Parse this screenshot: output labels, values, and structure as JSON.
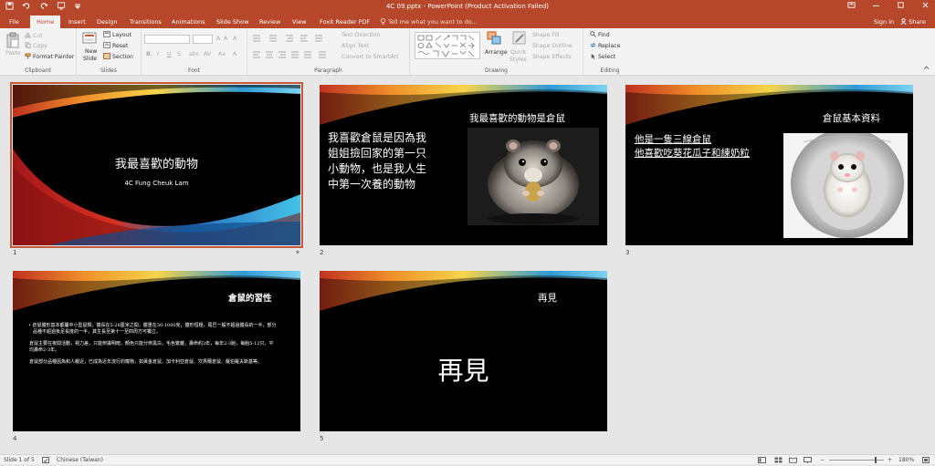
{
  "window": {
    "title": "4C 09.pptx - PowerPoint (Product Activation Failed)",
    "qat": [
      "save-icon",
      "undo-icon",
      "redo-icon",
      "slideshow-icon",
      "customize-icon"
    ],
    "controls": [
      "minimize",
      "restore",
      "maximize",
      "close"
    ]
  },
  "tabs": [
    "File",
    "Home",
    "Insert",
    "Design",
    "Transitions",
    "Animations",
    "Slide Show",
    "Review",
    "View",
    "Foxit Reader PDF"
  ],
  "tell_me": "Tell me what you want to do...",
  "sign_in": "Sign in",
  "share": "Share",
  "ribbon": {
    "clipboard": {
      "paste": "Paste",
      "cut": "Cut",
      "copy": "Copy",
      "format_painter": "Format Painter",
      "label": "Clipboard"
    },
    "slides": {
      "new_slide": "New",
      "new_slide2": "Slide",
      "layout": "Layout",
      "reset": "Reset",
      "section": "Section",
      "label": "Slides"
    },
    "font": {
      "bold": "B",
      "italic": "I",
      "underline": "U",
      "strike": "S",
      "label": "Font"
    },
    "paragraph": {
      "text_direction": "Text Direction",
      "align_text": "Align Text",
      "smartart": "Convert to SmartArt",
      "label": "Paragraph"
    },
    "drawing": {
      "arrange": "Arrange",
      "quick": "Quick",
      "styles": "Styles",
      "shape_fill": "Shape Fill",
      "shape_outline": "Shape Outline",
      "shape_effects": "Shape Effects",
      "label": "Drawing"
    },
    "editing": {
      "find": "Find",
      "replace": "Replace",
      "select": "Select",
      "label": "Editing"
    }
  },
  "slides": [
    {
      "num": "1",
      "title": "我最喜歡的動物",
      "subtitle": "4C  Fung  Cheuk Lam"
    },
    {
      "num": "2",
      "title": "我最喜歡的動物是倉鼠",
      "body": [
        "我喜歡倉鼠是因為我",
        "姐姐撿回家的第一只",
        "小動物，也是我人生",
        "中第一次養的動物"
      ]
    },
    {
      "num": "3",
      "title": "倉鼠基本資料",
      "body": [
        "他是一隻三線倉鼠",
        "他喜歡吃葵花瓜子和練奶粒"
      ]
    },
    {
      "num": "4",
      "title": "倉鼠的習性",
      "body": [
        "倉鼠體形基本都屬中小型鼠類，體長在5-28厘米之間，體重在30-1000克，體形短粗，尾巴一般不超過體長的一半，部分品種不超過後足長度的一半，其生長至第十一至四周方可獨立。",
        "倉鼠主要在夜間活動，視力差，只能辨識明暗，顏色只能分辨黑白，毛色繁雜，壽命約3年，每年2-3胎，每胎5-12只，平均壽命2-3年。",
        "倉鼠部分品種因為和人親近，已成為近年流行的寵物，如黃金倉鼠、加卡利亞倉鼠、坎貝爾倉鼠、羅伯羅夫斯基等。"
      ]
    },
    {
      "num": "5",
      "title": "再見",
      "body_big": "再見"
    }
  ],
  "status": {
    "slide_count": "Slide 1 of 5",
    "language": "Chinese (Taiwan)",
    "zoom": "180%"
  }
}
